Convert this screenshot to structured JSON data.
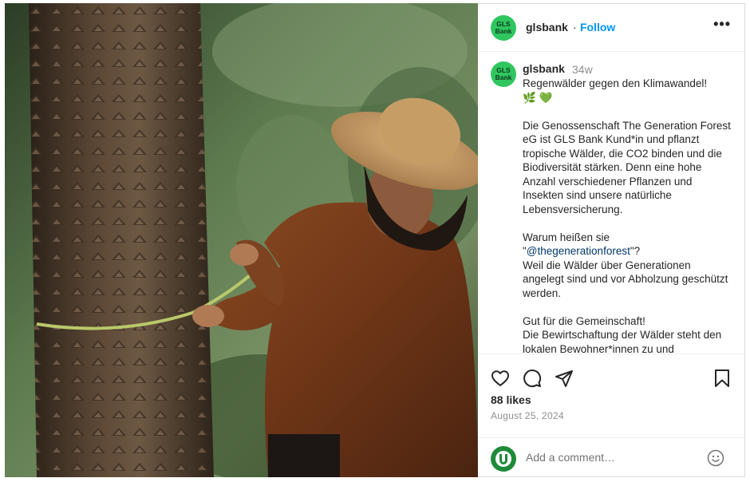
{
  "post": {
    "username": "glsbank",
    "separator": "·",
    "follow_label": "Follow",
    "more_label": "•••",
    "avatar_text_line1": "GLS",
    "avatar_text_line2": "Bank",
    "time_ago": "34w",
    "caption": {
      "line_1": "Regenwälder gegen den Klimawandel!",
      "emoji_leaf": "🌿",
      "emoji_heart": "💚",
      "paragraph_1": "Die Genossenschaft The Generation Forest eG ist GLS Bank Kund*in und pflanzt tropische Wälder, die CO2 binden und die Biodiversität stärken. Denn eine hohe Anzahl verschiedener Pflanzen und Insekten sind unsere natürliche Lebensversicherung.",
      "question_prefix": "Warum heißen sie",
      "mention_open_quote": "\"",
      "mention": "@thegenerationforest",
      "mention_close": "\"?",
      "paragraph_2": "Weil die Wälder über Generationen angelegt sind und vor Abholzung geschützt werden.",
      "paragraph_3_line_1": "Gut für die Gemeinschaft!",
      "paragraph_3_line_2": "Die Bewirtschaftung der Wälder steht den lokalen Bewohner*innen zu und"
    },
    "likes": "88 likes",
    "date": "August 25, 2024",
    "comment_placeholder": "Add a comment…",
    "comment_avatar_letter": "U"
  },
  "icons": {
    "like": "heart-icon",
    "comment": "comment-icon",
    "share": "send-icon",
    "save": "bookmark-icon",
    "emoji": "smiley-icon"
  },
  "colors": {
    "accent": "#0095f6",
    "avatar_bg": "#2fc660",
    "text": "#262626",
    "muted": "#8e8e8e",
    "mention": "#00376b"
  }
}
